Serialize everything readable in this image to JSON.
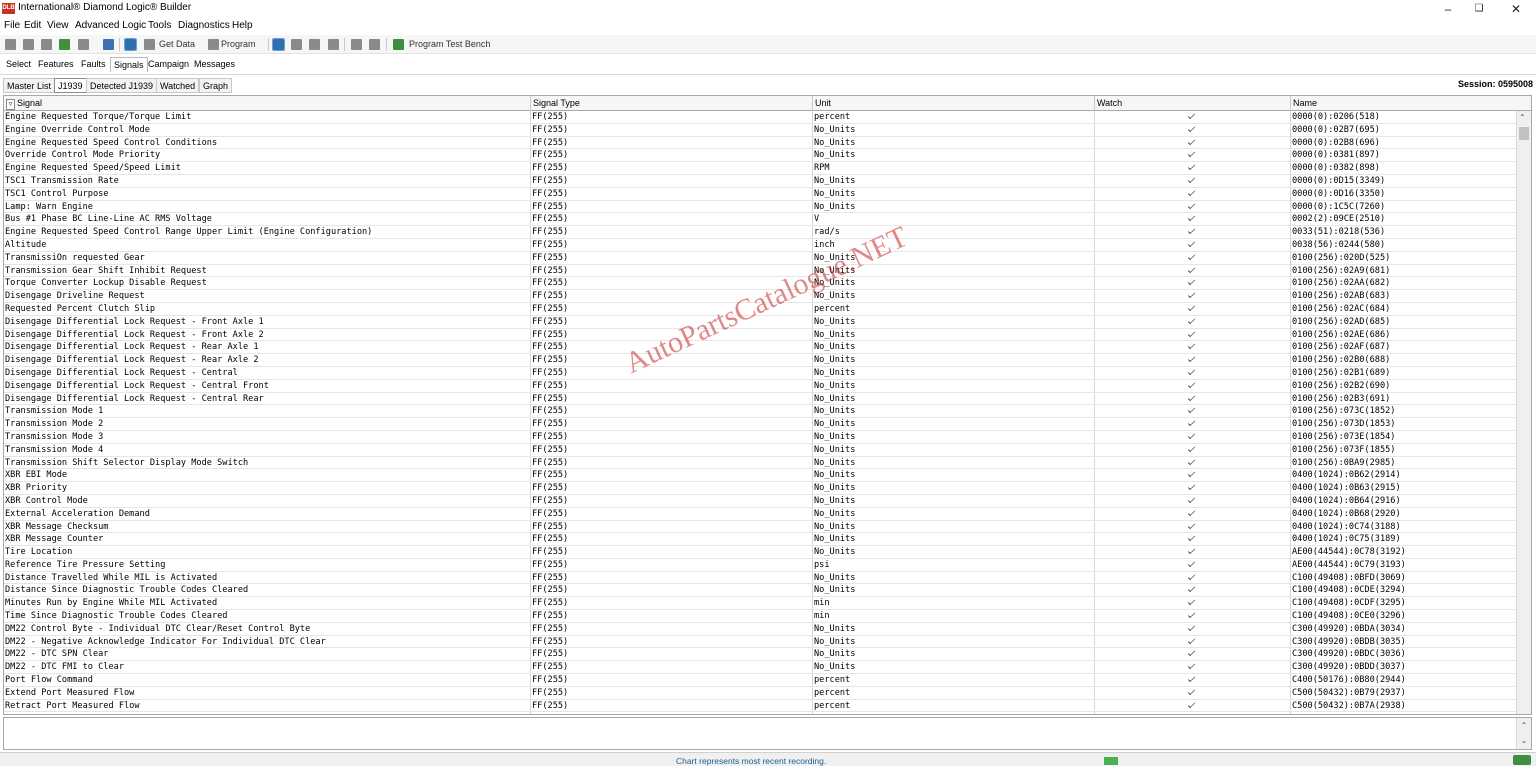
{
  "window": {
    "title": "International® Diamond Logic® Builder",
    "icon_label": "DLB"
  },
  "menu": [
    "File",
    "Edit",
    "View",
    "Advanced Logic",
    "Tools",
    "Diagnostics",
    "Help"
  ],
  "toolbar": {
    "get_data": "Get Data",
    "program": "Program",
    "program_test_bench": "Program Test Bench"
  },
  "tabs": [
    "Select",
    "Features",
    "Faults",
    "Signals",
    "Campaign",
    "Messages"
  ],
  "active_tab": "Signals",
  "subtabs": [
    "Master List",
    "J1939",
    "Detected J1939",
    "Watched",
    "Graph"
  ],
  "active_subtab": "J1939",
  "session": "Session: 0595008",
  "columns": [
    "Signal",
    "Signal Type",
    "Unit",
    "Watch",
    "Name"
  ],
  "rows": [
    [
      "Engine Requested Torque/Torque Limit",
      "FF(255)",
      "percent",
      "0000(0):0206(518)"
    ],
    [
      "Engine Override Control Mode",
      "FF(255)",
      "No_Units",
      "0000(0):02B7(695)"
    ],
    [
      "Engine Requested Speed Control Conditions",
      "FF(255)",
      "No_Units",
      "0000(0):02B8(696)"
    ],
    [
      "Override Control Mode Priority",
      "FF(255)",
      "No_Units",
      "0000(0):0381(897)"
    ],
    [
      "Engine Requested Speed/Speed Limit",
      "FF(255)",
      "RPM",
      "0000(0):0382(898)"
    ],
    [
      "TSC1 Transmission Rate",
      "FF(255)",
      "No_Units",
      "0000(0):0D15(3349)"
    ],
    [
      "TSC1 Control Purpose",
      "FF(255)",
      "No_Units",
      "0000(0):0D16(3350)"
    ],
    [
      "Lamp: Warn Engine",
      "FF(255)",
      "No_Units",
      "0000(0):1C5C(7260)"
    ],
    [
      "Bus #1 Phase BC Line-Line AC RMS Voltage",
      "FF(255)",
      "V",
      "0002(2):09CE(2510)"
    ],
    [
      "Engine Requested Speed Control Range Upper Limit (Engine Configuration)",
      "FF(255)",
      "rad/s",
      "0033(51):0218(536)"
    ],
    [
      "Altitude",
      "FF(255)",
      "inch",
      "0038(56):0244(580)"
    ],
    [
      "TransmissiOn requested Gear",
      "FF(255)",
      "No_Units",
      "0100(256):020D(525)"
    ],
    [
      "Transmission Gear Shift Inhibit Request",
      "FF(255)",
      "No_Units",
      "0100(256):02A9(681)"
    ],
    [
      "Torque Converter Lockup Disable Request",
      "FF(255)",
      "No_Units",
      "0100(256):02AA(682)"
    ],
    [
      "Disengage Driveline Request",
      "FF(255)",
      "No_Units",
      "0100(256):02AB(683)"
    ],
    [
      "Requested Percent Clutch Slip",
      "FF(255)",
      "percent",
      "0100(256):02AC(684)"
    ],
    [
      "Disengage Differential Lock Request - Front Axle 1",
      "FF(255)",
      "No_Units",
      "0100(256):02AD(685)"
    ],
    [
      "Disengage Differential Lock Request - Front Axle 2",
      "FF(255)",
      "No_Units",
      "0100(256):02AE(686)"
    ],
    [
      "Disengage Differential Lock Request - Rear Axle 1",
      "FF(255)",
      "No_Units",
      "0100(256):02AF(687)"
    ],
    [
      "Disengage Differential Lock Request - Rear Axle 2",
      "FF(255)",
      "No_Units",
      "0100(256):02B0(688)"
    ],
    [
      "Disengage Differential Lock Request - Central",
      "FF(255)",
      "No_Units",
      "0100(256):02B1(689)"
    ],
    [
      "Disengage Differential Lock Request - Central Front",
      "FF(255)",
      "No_Units",
      "0100(256):02B2(690)"
    ],
    [
      "Disengage Differential Lock Request - Central Rear",
      "FF(255)",
      "No_Units",
      "0100(256):02B3(691)"
    ],
    [
      "Transmission Mode 1",
      "FF(255)",
      "No_Units",
      "0100(256):073C(1852)"
    ],
    [
      "Transmission Mode 2",
      "FF(255)",
      "No_Units",
      "0100(256):073D(1853)"
    ],
    [
      "Transmission Mode 3",
      "FF(255)",
      "No_Units",
      "0100(256):073E(1854)"
    ],
    [
      "Transmission Mode 4",
      "FF(255)",
      "No_Units",
      "0100(256):073F(1855)"
    ],
    [
      "Transmission Shift Selector Display Mode Switch",
      "FF(255)",
      "No_Units",
      "0100(256):0BA9(2985)"
    ],
    [
      "XBR EBI Mode",
      "FF(255)",
      "No_Units",
      "0400(1024):0B62(2914)"
    ],
    [
      "XBR Priority",
      "FF(255)",
      "No_Units",
      "0400(1024):0B63(2915)"
    ],
    [
      "XBR Control Mode",
      "FF(255)",
      "No_Units",
      "0400(1024):0B64(2916)"
    ],
    [
      "External Acceleration Demand",
      "FF(255)",
      "No_Units",
      "0400(1024):0B68(2920)"
    ],
    [
      "XBR Message Checksum",
      "FF(255)",
      "No_Units",
      "0400(1024):0C74(3188)"
    ],
    [
      "XBR Message Counter",
      "FF(255)",
      "No_Units",
      "0400(1024):0C75(3189)"
    ],
    [
      "Tire Location",
      "FF(255)",
      "No_Units",
      "AE00(44544):0C78(3192)"
    ],
    [
      "Reference Tire Pressure Setting",
      "FF(255)",
      "psi",
      "AE00(44544):0C79(3193)"
    ],
    [
      "Distance Travelled While MIL is Activated",
      "FF(255)",
      "No_Units",
      "C100(49408):0BFD(3069)"
    ],
    [
      "Distance Since Diagnostic Trouble Codes Cleared",
      "FF(255)",
      "No_Units",
      "C100(49408):0CDE(3294)"
    ],
    [
      "Minutes Run by Engine While MIL Activated",
      "FF(255)",
      "min",
      "C100(49408):0CDF(3295)"
    ],
    [
      "Time Since Diagnostic Trouble Codes Cleared",
      "FF(255)",
      "min",
      "C100(49408):0CE0(3296)"
    ],
    [
      "DM22 Control Byte - Individual DTC Clear/Reset Control Byte",
      "FF(255)",
      "No_Units",
      "C300(49920):0BDA(3034)"
    ],
    [
      "DM22 - Negative Acknowledge Indicator For Individual DTC Clear",
      "FF(255)",
      "No_Units",
      "C300(49920):0BDB(3035)"
    ],
    [
      "DM22 - DTC SPN Clear",
      "FF(255)",
      "No_Units",
      "C300(49920):0BDC(3036)"
    ],
    [
      "DM22 - DTC FMI to Clear",
      "FF(255)",
      "No_Units",
      "C300(49920):0BDD(3037)"
    ],
    [
      "Port Flow Command",
      "FF(255)",
      "percent",
      "C400(50176):0B80(2944)"
    ],
    [
      "Extend Port Measured Flow",
      "FF(255)",
      "percent",
      "C500(50432):0B79(2937)"
    ],
    [
      "Retract Port Measured Flow",
      "FF(255)",
      "percent",
      "C500(50432):0B7A(2938)"
    ]
  ],
  "status": "Chart represents most recent recording.",
  "watermark": "AutoPartsCatalogue.NET"
}
